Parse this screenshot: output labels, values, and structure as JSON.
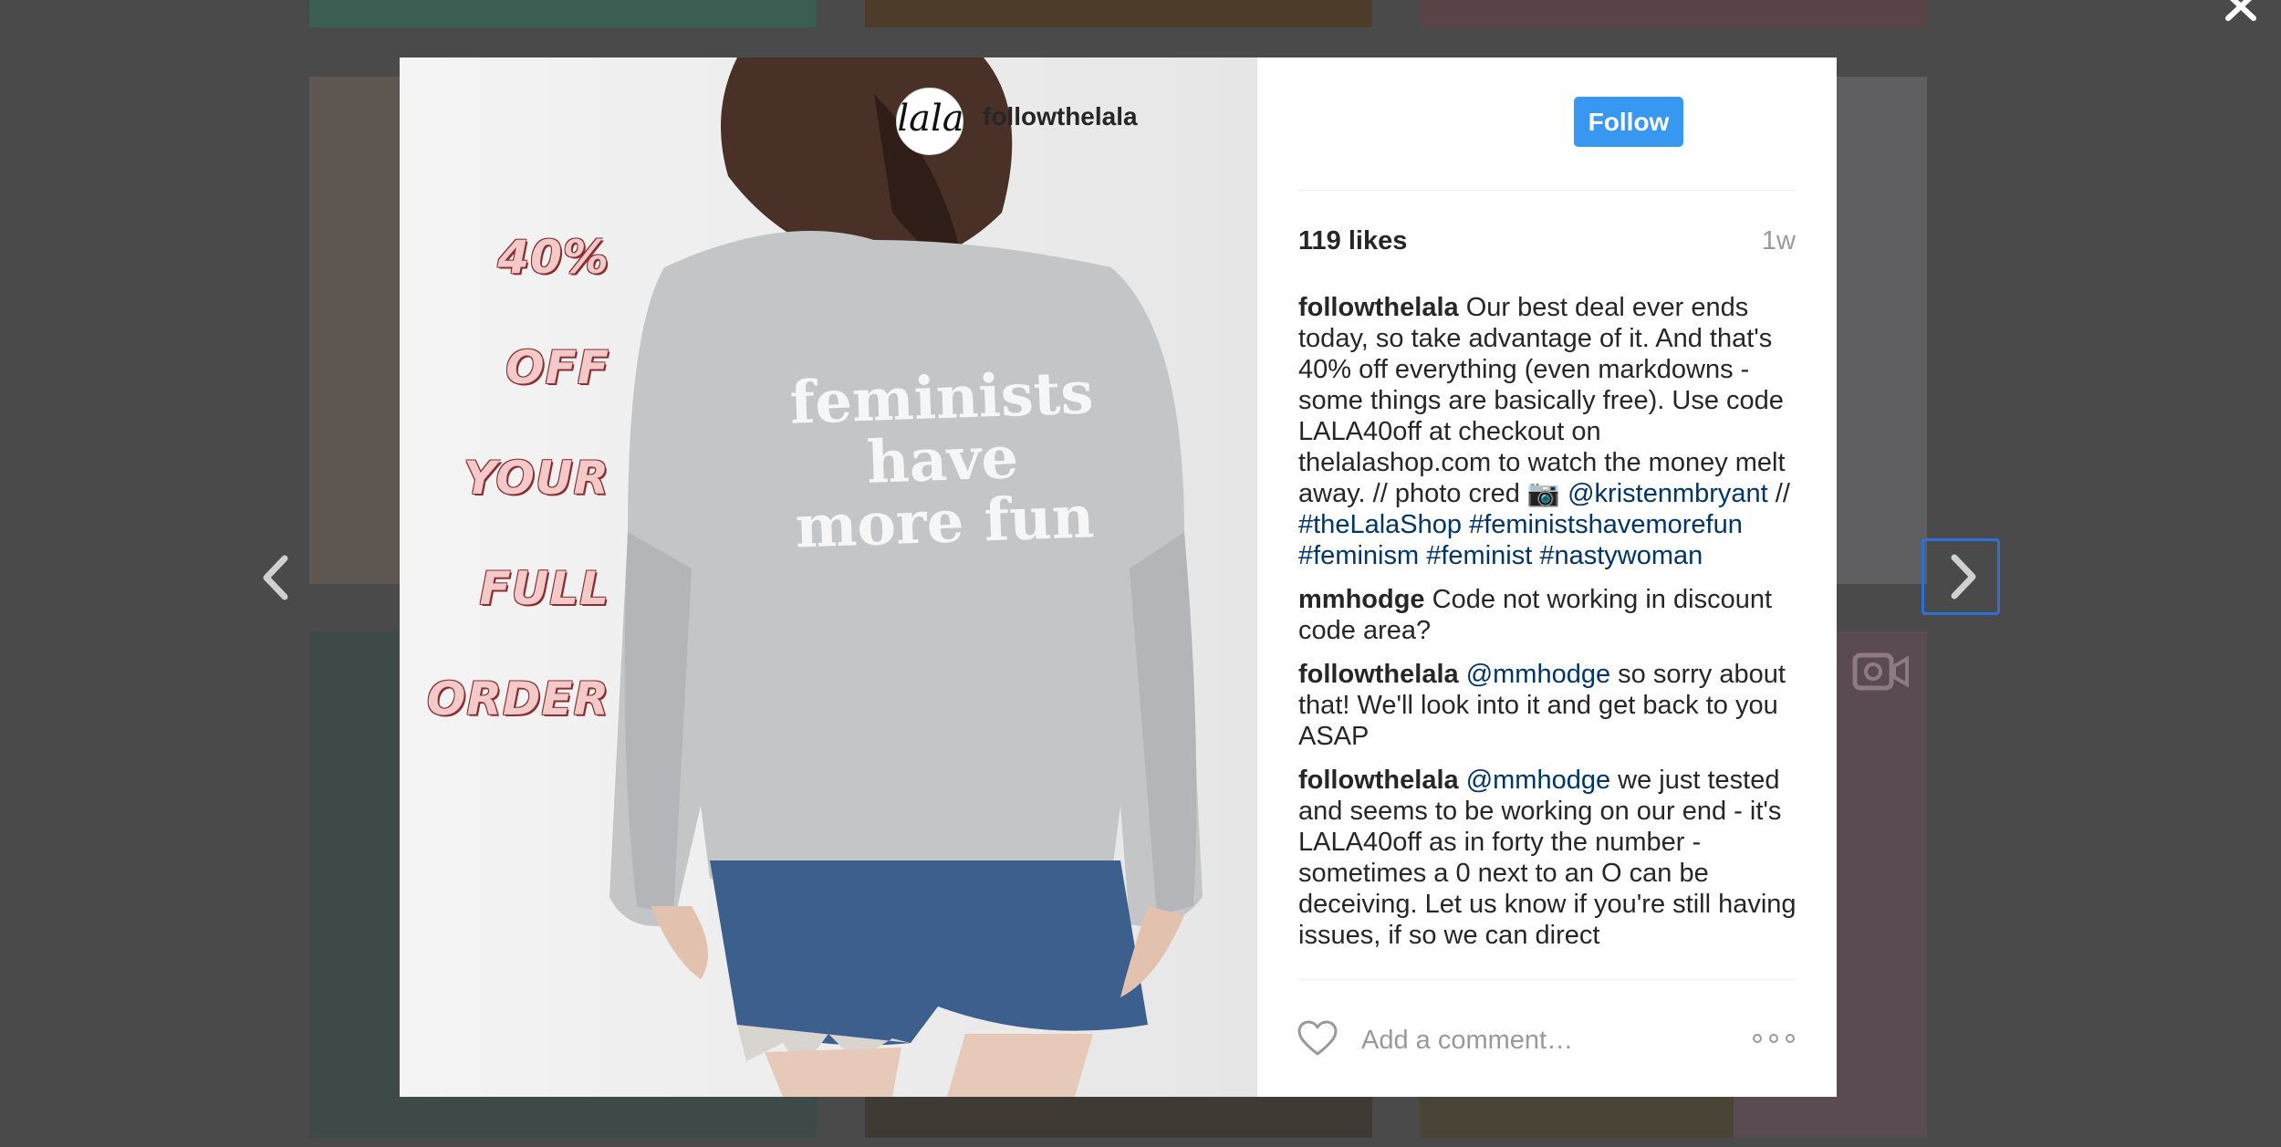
{
  "post": {
    "username": "followthelala",
    "follow_label": "Follow",
    "likes": "119 likes",
    "time": "1w",
    "avatar_text": "lala"
  },
  "image": {
    "promo_lines": [
      "40%",
      "OFF",
      "YOUR",
      "FULL",
      "ORDER"
    ],
    "shirt_lines": [
      "feminists",
      "have",
      "more fun"
    ]
  },
  "comments": [
    {
      "user": "followthelala",
      "text_1": "Our best deal ever ends today, so take advantage of it. And that's 40% off everything (even markdowns - some things are basically free). Use code LALA40off at checkout on thelalashop.com to watch the money melt away. // photo cred 📷",
      "tag_1": "@kristenmbryant",
      "sep": "//",
      "tag_2": "#theLalaShop",
      "tag_3": "#feministshavemorefun",
      "tag_4": "#feminism",
      "tag_5": "#feminist",
      "tag_6": "#nastywoman"
    },
    {
      "user": "mmhodge",
      "text": "Code not working in discount code area?"
    },
    {
      "user": "followthelala",
      "mention": "@mmhodge",
      "text": "so sorry about that! We'll look into it and get back to you ASAP"
    },
    {
      "user": "followthelala",
      "mention": "@mmhodge",
      "text": "we just tested and seems to be working on our end - it's LALA40off as in forty the number - sometimes a 0 next to an O can be deceiving. Let us know if you're still having issues, if so we can direct"
    }
  ],
  "comment_input": {
    "placeholder": "Add a comment…"
  },
  "icons": {
    "close": "close-icon",
    "prev": "chevron-left-icon",
    "next": "chevron-right-icon",
    "heart": "heart-icon",
    "more": "more-options-icon",
    "video": "video-icon"
  },
  "colors": {
    "follow": "#3897f0",
    "hashtag": "#003569",
    "overlay": "#4a4a4a",
    "focus_outline": "#2e6fd8"
  }
}
